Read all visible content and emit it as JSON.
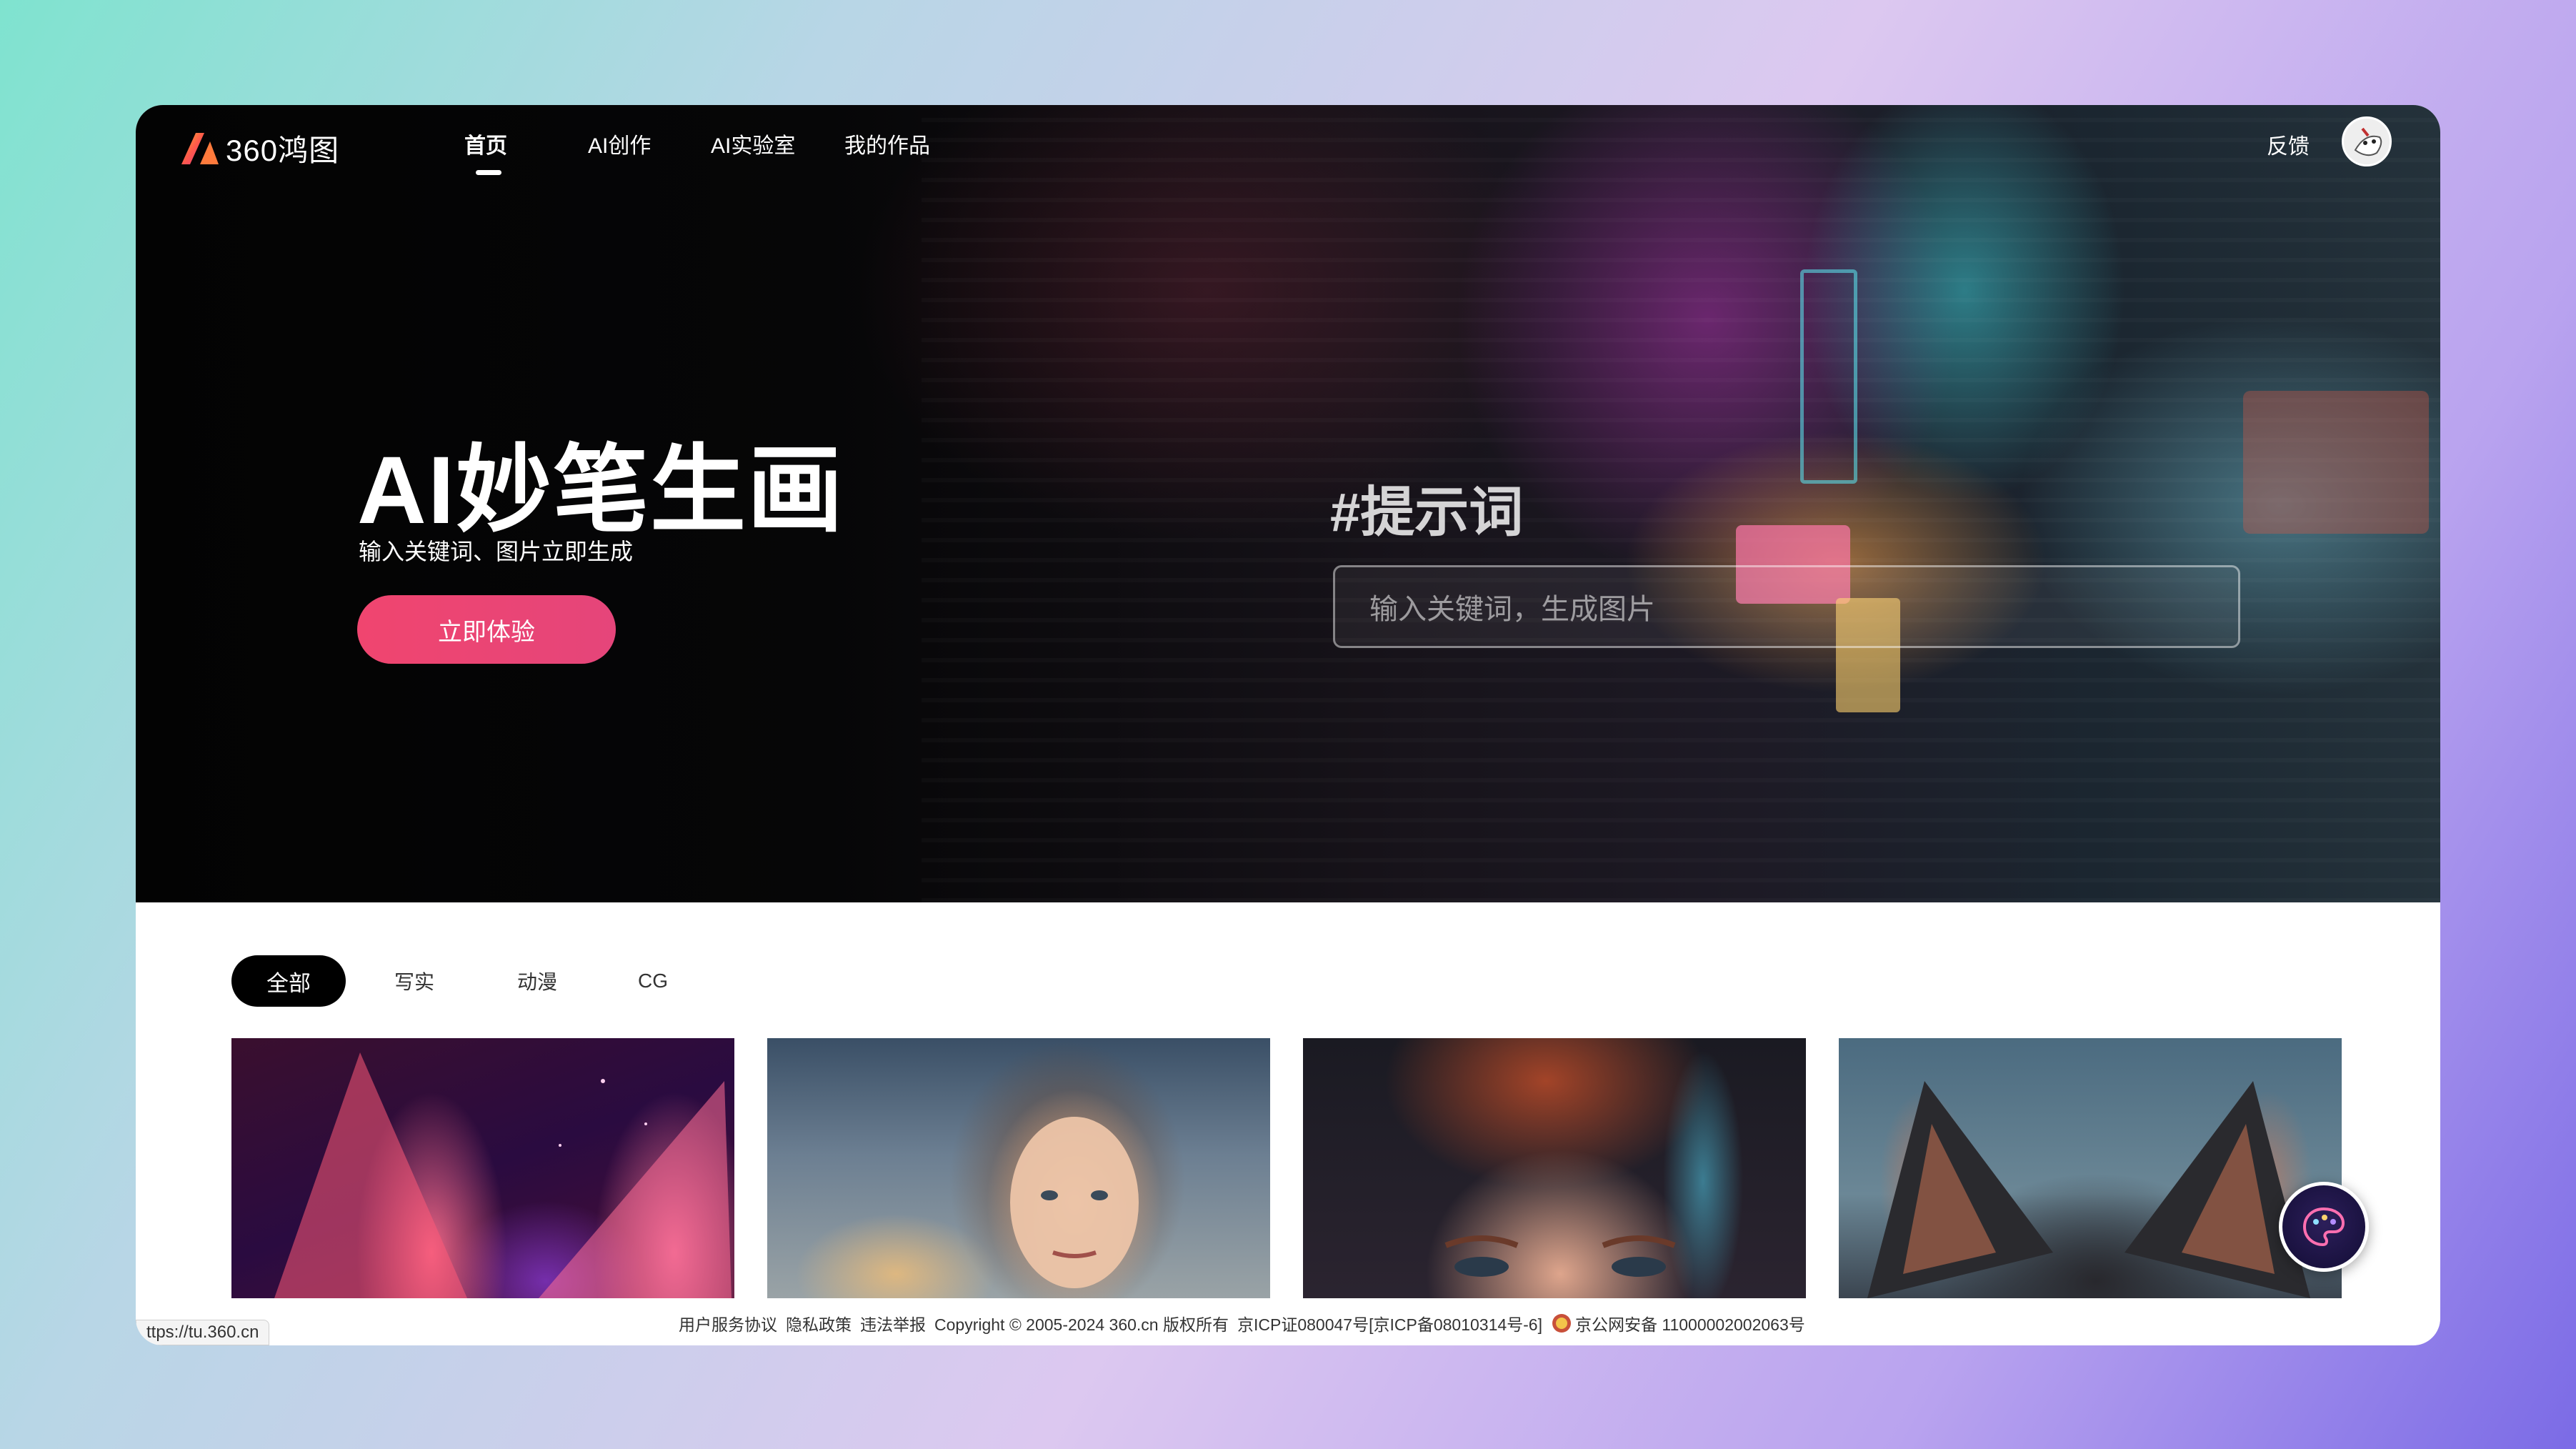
{
  "app": {
    "logo_text": "360鸿图"
  },
  "nav": {
    "items": [
      {
        "label": "首页",
        "active": true
      },
      {
        "label": "AI创作",
        "active": false
      },
      {
        "label": "AI实验室",
        "active": false
      },
      {
        "label": "我的作品",
        "active": false
      }
    ],
    "feedback_label": "反馈"
  },
  "hero": {
    "title": "AI妙笔生画",
    "subtitle": "输入关键词、图片立即生成",
    "cta_label": "立即体验",
    "prompt_tag": "#提示词",
    "search_placeholder": "输入关键词，生成图片"
  },
  "tabs": {
    "items": [
      {
        "label": "全部",
        "active": true
      },
      {
        "label": "写实",
        "active": false
      },
      {
        "label": "动漫",
        "active": false
      },
      {
        "label": "CG",
        "active": false
      }
    ]
  },
  "gallery": {
    "cards": [
      {
        "subject": "fox-ears"
      },
      {
        "subject": "woman-portrait"
      },
      {
        "subject": "redhead-portrait"
      },
      {
        "subject": "wolf"
      }
    ]
  },
  "footer": {
    "user_agreement": "用户服务协议",
    "privacy": "隐私政策",
    "report": "违法举报",
    "copyright": "Copyright © 2005-2024 360.cn 版权所有",
    "icp": "京ICP证080047号[京ICP备08010314号-6]",
    "police": "京公网安备 11000002002063号"
  },
  "status_bar": {
    "url": "ttps://tu.360.cn"
  },
  "colors": {
    "cta": "#f0456f",
    "active_tab_bg": "#000000",
    "page_bg_gradient_start": "#7fe3cf",
    "page_bg_gradient_end": "#7b6be6"
  },
  "icons": {
    "logo": "360-honotu-logo-icon",
    "avatar": "user-avatar",
    "float": "palette-assistant-icon",
    "police": "police-badge-icon"
  }
}
